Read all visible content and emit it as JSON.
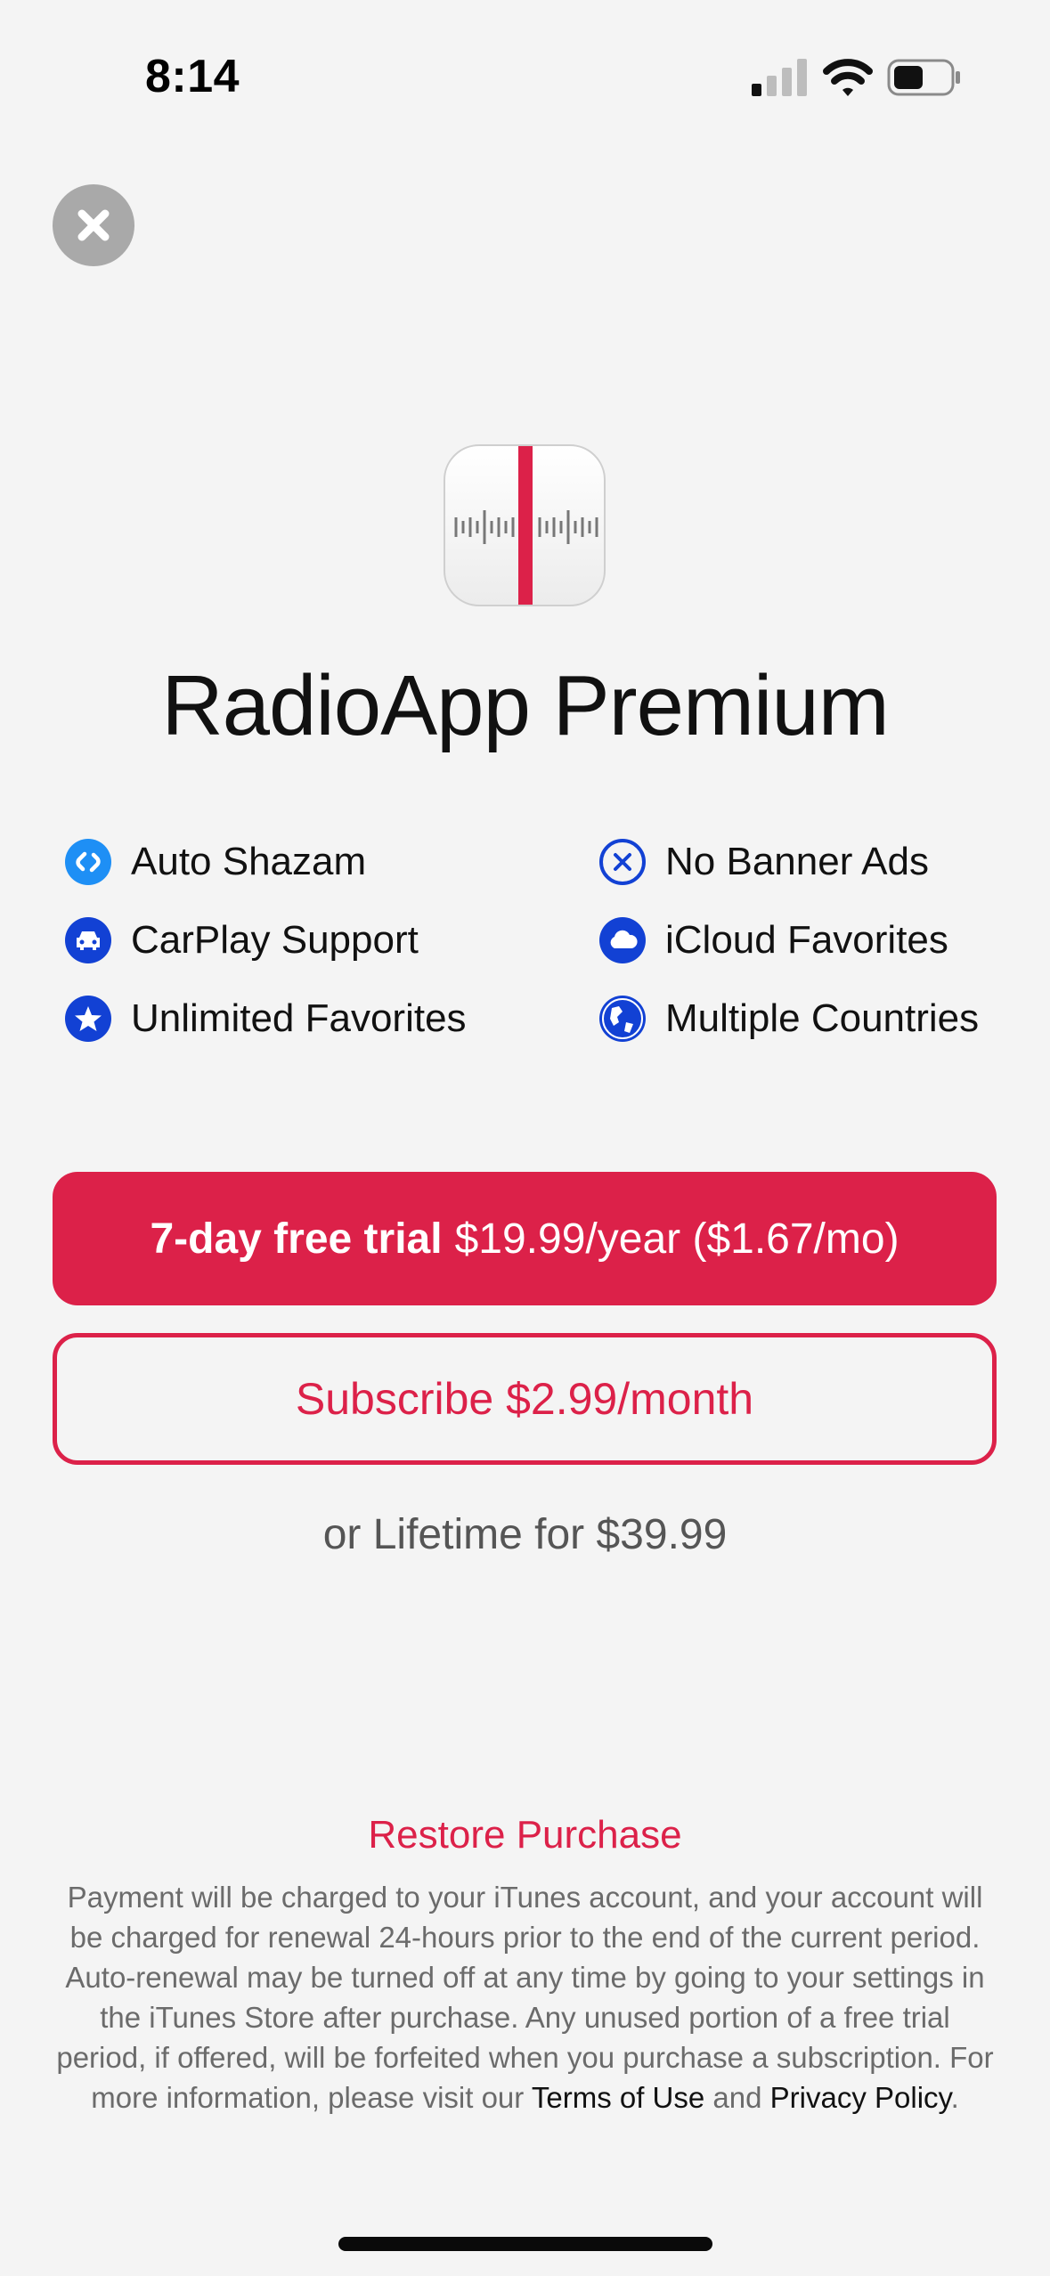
{
  "status_bar": {
    "time": "8:14"
  },
  "app": {
    "title": "RadioApp Premium"
  },
  "features": {
    "left": [
      {
        "label": "Auto Shazam",
        "icon": "shazam-icon"
      },
      {
        "label": "CarPlay Support",
        "icon": "car-icon"
      },
      {
        "label": "Unlimited Favorites",
        "icon": "star-icon"
      }
    ],
    "right": [
      {
        "label": "No Banner Ads",
        "icon": "no-ads-icon"
      },
      {
        "label": "iCloud Favorites",
        "icon": "cloud-icon"
      },
      {
        "label": "Multiple Countries",
        "icon": "globe-icon"
      }
    ]
  },
  "offers": {
    "trial_bold": "7-day free trial",
    "trial_price": "$19.99/year ($1.67/mo)",
    "subscribe": "Subscribe $2.99/month",
    "lifetime": "or Lifetime for $39.99"
  },
  "restore": "Restore Purchase",
  "legal": {
    "text": "Payment will be charged to your iTunes account, and your account will be charged for renewal 24-hours prior to the end of the current period. Auto-renewal may be turned off at any time by going to your settings in the iTunes Store after purchase. Any unused portion of a free trial period, if offered, will be forfeited when you purchase a subscription. For more information, please visit our",
    "terms": "Terms of Use",
    "and": "and",
    "privacy": "Privacy Policy",
    "end": "."
  },
  "colors": {
    "accent": "#dc2149",
    "icon_blue": "#1241d4",
    "shazam_blue": "#1e8ff5"
  }
}
